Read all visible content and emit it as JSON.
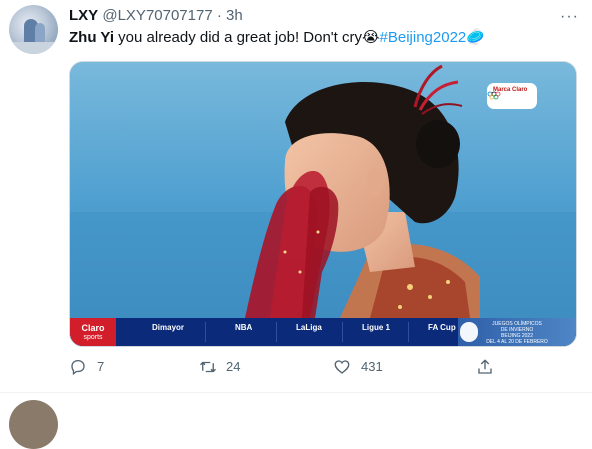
{
  "tweet": {
    "author_name": "LXY",
    "author_handle": "@LXY70707177",
    "separator": "·",
    "time": "3h",
    "more_label": "···",
    "text_bold": "Zhu Yi",
    "text_main": " you already did a great job! Don't cry",
    "text_emoji": "😭",
    "hashtag": "#Beijing2022",
    "hashtag_emoji": "🥏"
  },
  "media": {
    "broadcast_logo": "Marca Claro",
    "scorebar": {
      "brand": "Claro",
      "brand_sub": "sports",
      "items": [
        "Dimayor",
        "NBA",
        "LaLiga",
        "Ligue 1",
        "FA Cup"
      ],
      "olympic_text": [
        "JUEGOS OLÍMPICOS",
        "DE INVIERNO",
        "BEIJING 2022",
        "DEL 4 AL 20 DE FEBRERO"
      ]
    }
  },
  "actions": {
    "reply_count": "7",
    "retweet_count": "24",
    "like_count": "431"
  },
  "colors": {
    "accent": "#1d9bf0",
    "text": "#0f1419",
    "muted": "#536471"
  },
  "icons": [
    "reply-icon",
    "retweet-icon",
    "like-icon",
    "share-icon",
    "more-icon"
  ]
}
